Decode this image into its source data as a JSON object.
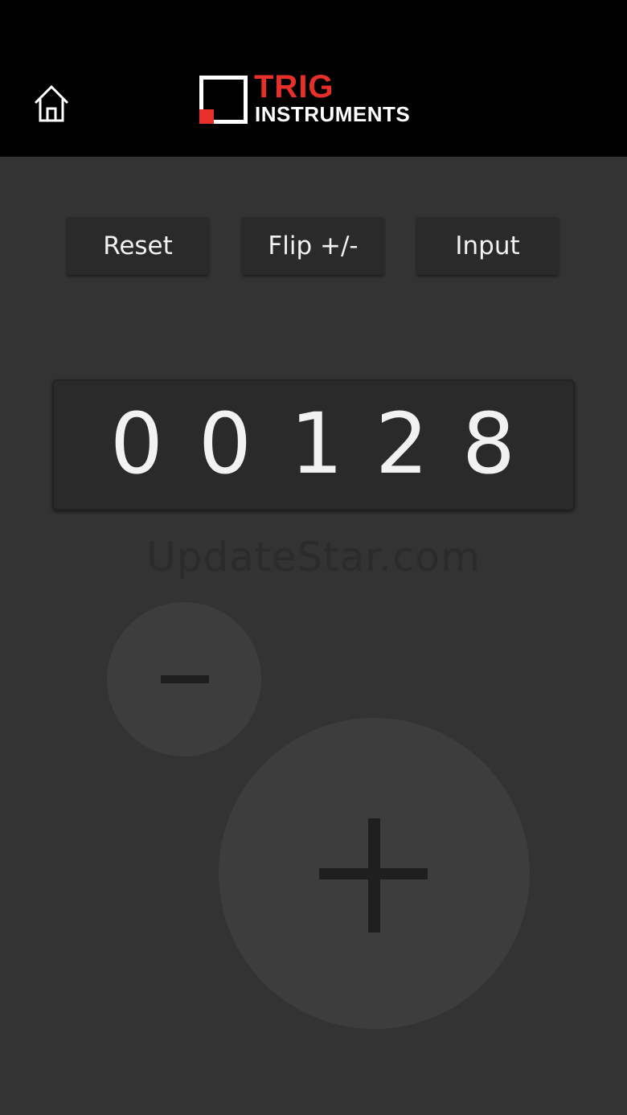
{
  "header": {
    "home_icon": "home-icon",
    "logo": {
      "line1": "TRIG",
      "line2": "INSTRUMENTS",
      "accent_color": "#e8302a"
    }
  },
  "toolbar": {
    "reset_label": "Reset",
    "flip_label": "Flip +/-",
    "input_label": "Input"
  },
  "counter": {
    "digits": [
      "0",
      "0",
      "1",
      "2",
      "8"
    ]
  },
  "watermark": "UpdateStar.com",
  "controls": {
    "minus_icon": "minus-icon",
    "plus_icon": "plus-icon"
  },
  "colors": {
    "background": "#333333",
    "header": "#000000",
    "button": "#2a2a2a",
    "round_button": "#3d3d3d",
    "text": "#f2f2f2"
  }
}
